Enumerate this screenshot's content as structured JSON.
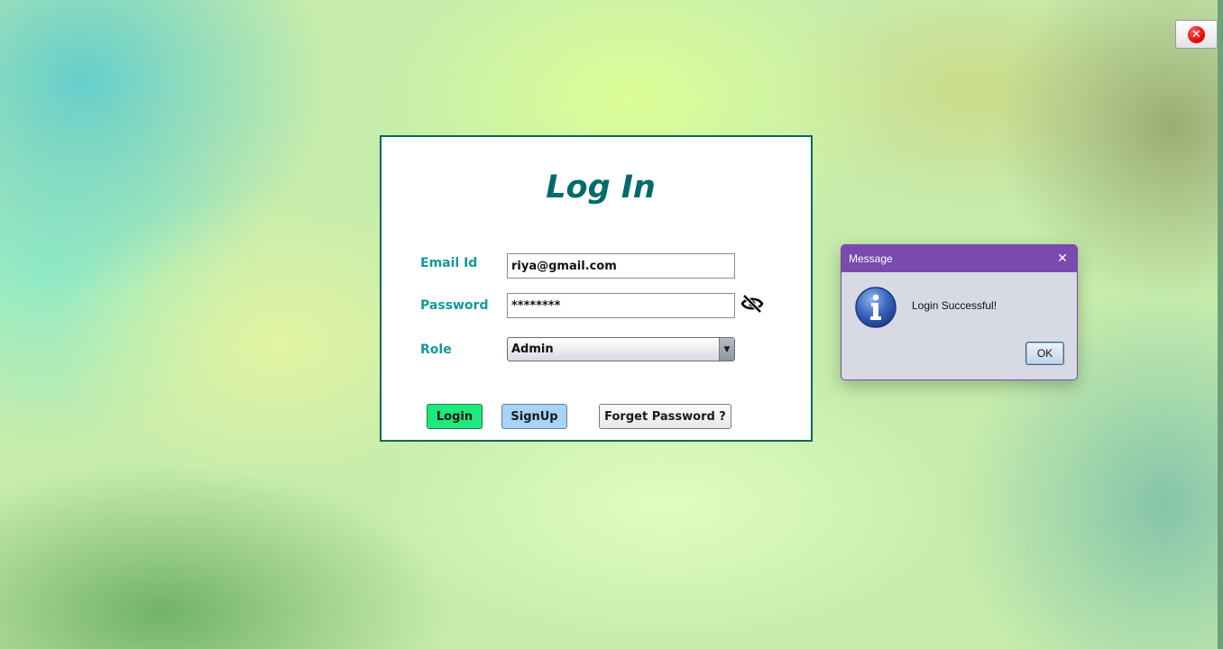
{
  "app": {
    "close_glyph": "✕"
  },
  "login_form": {
    "title": "Log In",
    "email": {
      "label": "Email Id",
      "value": "riya@gmail.com"
    },
    "password": {
      "label": "Password",
      "value": "********",
      "toggle_icon": "eye-slash-icon"
    },
    "role": {
      "label": "Role",
      "value": "Admin",
      "arrow_glyph": "▼"
    },
    "buttons": {
      "login": "Login",
      "signup": "SignUp",
      "forget": "Forget Password ?"
    }
  },
  "dialog": {
    "title": "Message",
    "close_glyph": "✕",
    "icon": "info-icon",
    "message": "Login Successful!",
    "ok_label": "OK"
  },
  "colors": {
    "panel_border": "#00695c",
    "title": "#006b6b",
    "label": "#119a9a",
    "login_button": "#1de97d",
    "signup_button": "#a8d2f7",
    "dialog_titlebar": "#7a4aad"
  }
}
